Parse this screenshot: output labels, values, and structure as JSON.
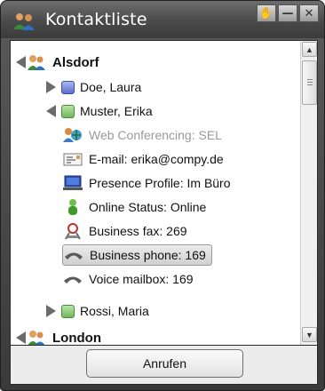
{
  "window": {
    "title": "Kontaktliste",
    "title_buttons": [
      "✋",
      "—",
      "✕"
    ]
  },
  "tree": {
    "groups": [
      {
        "name": "Alsdorf",
        "expanded": true,
        "icon": "group-icon"
      },
      {
        "name": "London",
        "expanded": false,
        "icon": "group-icon"
      }
    ],
    "contacts": [
      {
        "name": "Doe, Laura",
        "expanded": false,
        "status_color": "#6a7bd8"
      },
      {
        "name": "Muster, Erika",
        "expanded": true,
        "status_color": "#7cc06a"
      },
      {
        "name": "Rossi, Maria",
        "expanded": false,
        "status_color": "#7cc06a"
      }
    ],
    "details": [
      {
        "label": "Web Conferencing: SEL",
        "icon": "web-conferencing-icon",
        "disabled": true
      },
      {
        "label": "E-mail: erika@compy.de",
        "icon": "email-icon"
      },
      {
        "label": "Presence Profile: Im Büro",
        "icon": "presence-profile-icon"
      },
      {
        "label": "Online Status: Online",
        "icon": "online-status-icon"
      },
      {
        "label": "Business fax: 269",
        "icon": "fax-icon"
      },
      {
        "label": "Business phone: 169",
        "icon": "phone-icon",
        "selected": true
      },
      {
        "label": "Voice mailbox: 169",
        "icon": "voicemail-icon"
      }
    ]
  },
  "footer": {
    "call_button": "Anrufen"
  },
  "colors": {
    "titlebar": "#4a4a4a",
    "selection": "#d8d8d8",
    "online_green": "#7cc06a",
    "blue_status": "#6a7bd8"
  }
}
